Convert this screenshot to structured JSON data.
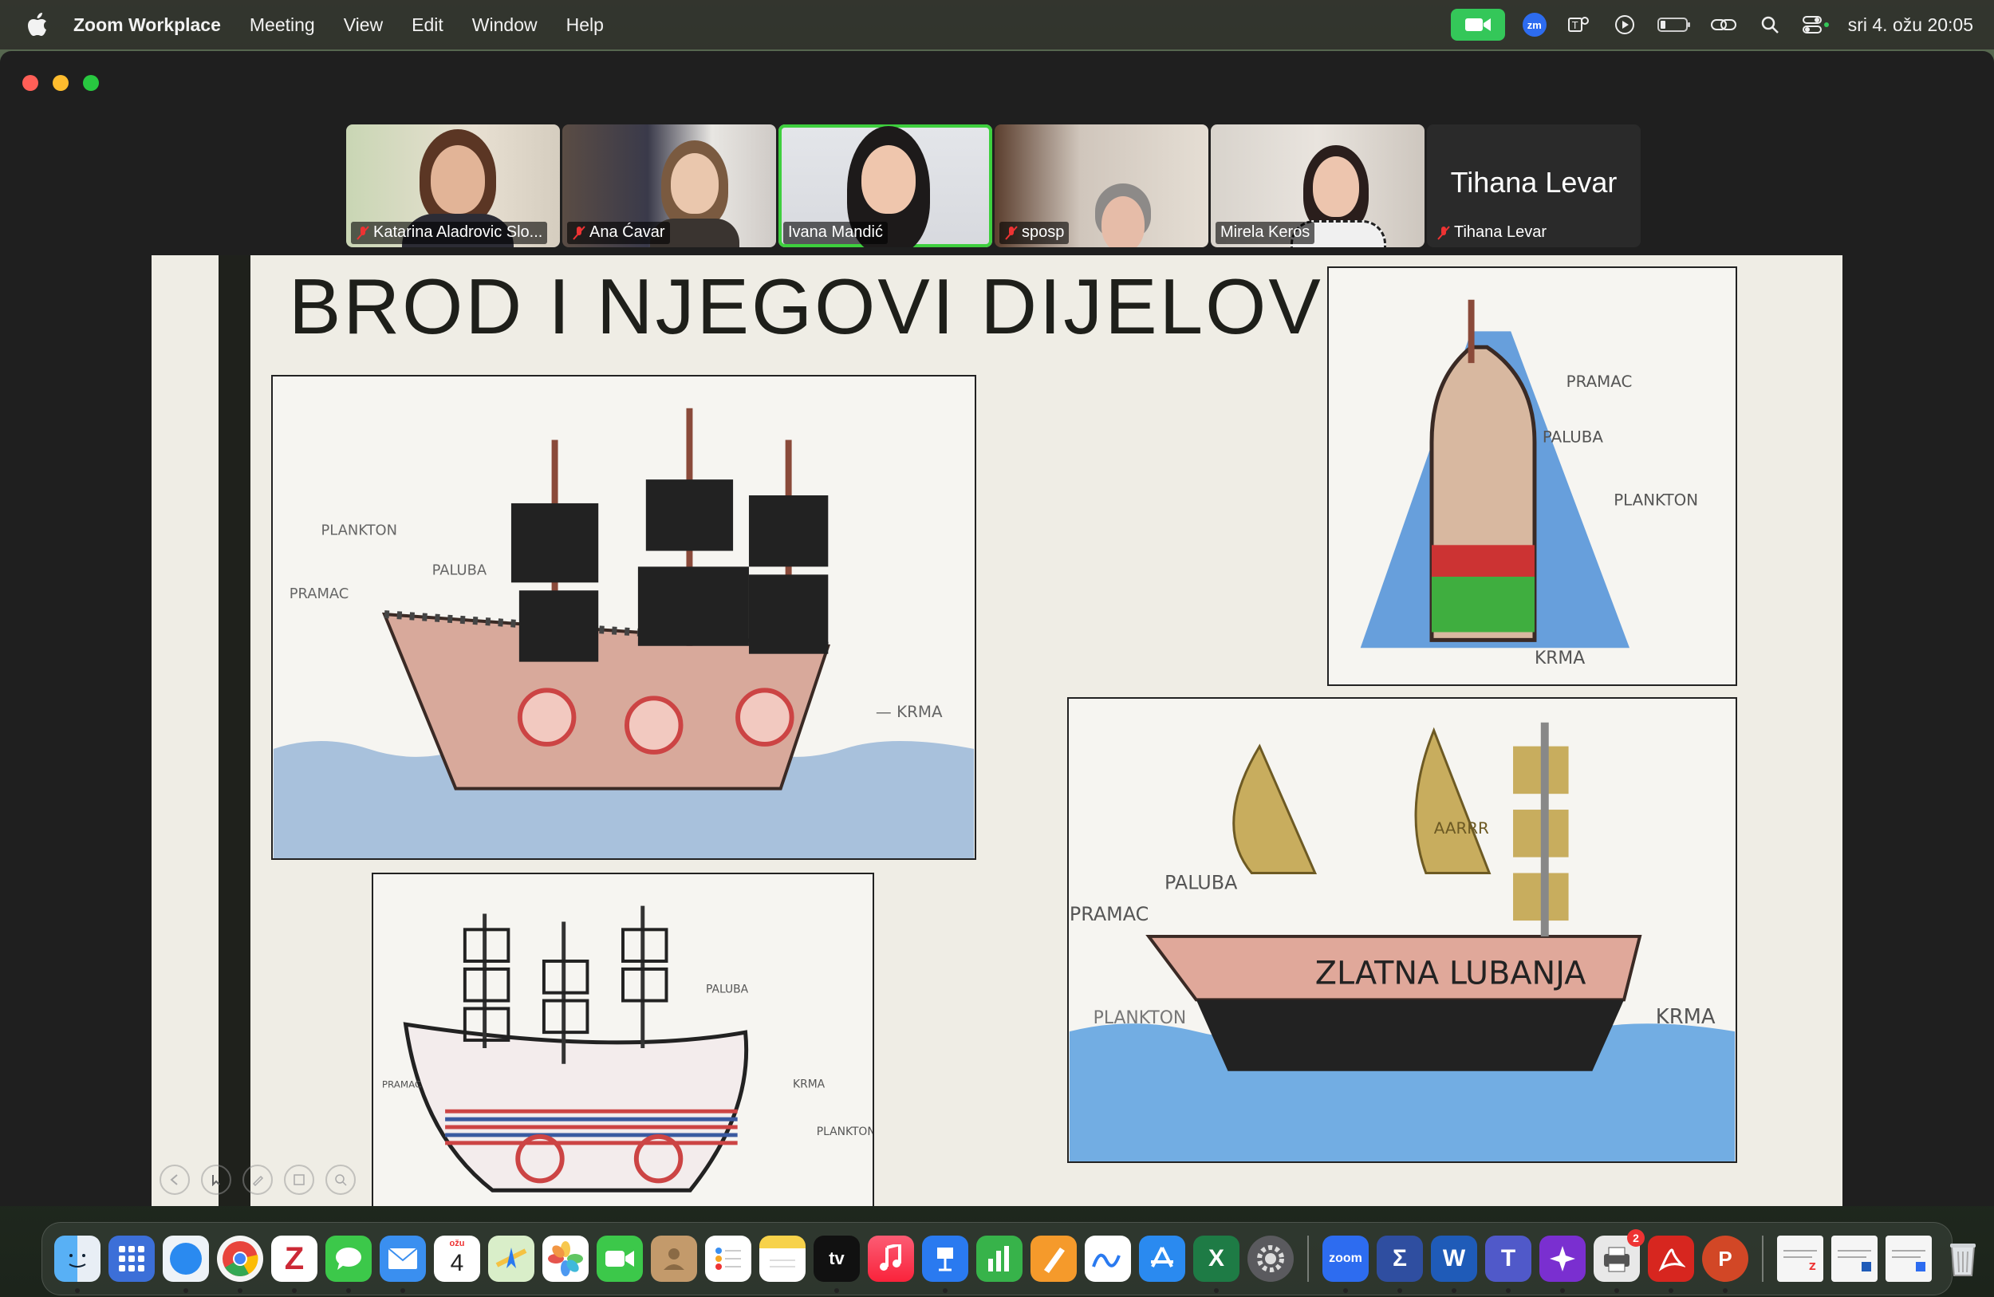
{
  "menubar": {
    "app_name": "Zoom Workplace",
    "items": [
      "Meeting",
      "View",
      "Edit",
      "Window",
      "Help"
    ],
    "clock": "sri 4. ožu  20:05",
    "status_icons": [
      "zoom-camera-icon",
      "zoom-zm-icon",
      "teams-icon",
      "play-icon",
      "battery-icon",
      "link-icon",
      "search-icon",
      "control-center-icon"
    ],
    "zm_label": "zm"
  },
  "participants": [
    {
      "name": "Katarina Aladrovic Slo...",
      "muted": true,
      "active": false
    },
    {
      "name": "Ana Ćavar",
      "muted": true,
      "active": false
    },
    {
      "name": "Ivana Mandić",
      "muted": false,
      "active": true
    },
    {
      "name": "sposp",
      "muted": true,
      "active": false
    },
    {
      "name": "Mirela Keros",
      "muted": false,
      "active": false
    },
    {
      "name": "Tihana Levar",
      "muted": true,
      "active": false,
      "video_off": true
    }
  ],
  "slide": {
    "title": "BROD I NJEGOVI DIJELOVI",
    "drawing1": {
      "labels": [
        "PLANKTON",
        "PALUBA",
        "PRAMAC",
        "KRMA"
      ]
    },
    "drawing2": {
      "labels": [
        "PRAMAC",
        "PALUBA",
        "PLANKTON",
        "KRMA"
      ]
    },
    "drawing3": {
      "labels": [
        "PALUBA",
        "PRAMAC",
        "KRMA",
        "PLANKTON"
      ]
    },
    "drawing4": {
      "labels": [
        "PRAMAC",
        "PALUBA",
        "ZLATNA LUBANJA",
        "PLANKTON",
        "KRMA",
        "AARRR"
      ]
    }
  },
  "dock": {
    "calendar_month": "ožu",
    "calendar_day": "4",
    "appletv_label": "tv",
    "zoom_label": "zoom",
    "printer_badge": "2",
    "apps": [
      "finder",
      "launchpad",
      "safari",
      "chrome",
      "zotero",
      "messages",
      "mail",
      "calendar",
      "maps",
      "photos",
      "facetime",
      "contacts",
      "reminders",
      "notes",
      "appletv",
      "music",
      "keynote",
      "numbers",
      "pages",
      "freeform",
      "appstore",
      "excel",
      "system-settings",
      "zoom",
      "sigma",
      "word",
      "teams",
      "copilot",
      "printer",
      "acrobat",
      "powerpoint",
      "doc-preview-1",
      "doc-preview-2",
      "doc-preview-3",
      "trash"
    ]
  },
  "colors": {
    "zoom_active_border": "#3ecf3e",
    "zoom_cam_green": "#34c759",
    "slide_background": "#efede5",
    "slide_bar": "#1f211c"
  }
}
